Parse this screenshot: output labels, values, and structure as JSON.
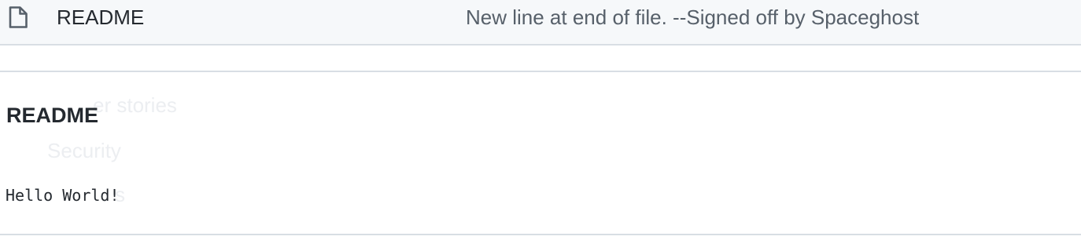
{
  "file_list": {
    "rows": [
      {
        "icon": "file-icon",
        "name": "README",
        "commit_message": "New line at end of file. --Signed off by Spaceghost"
      }
    ]
  },
  "readme": {
    "title": "README",
    "content": "Hello World!"
  },
  "background_ghost_text": {
    "line_1": "er stories",
    "line_2": "Security",
    "line_3": "s"
  },
  "colors": {
    "row_background": "#f6f8fa",
    "border": "#d8dee4",
    "text": "#24292f",
    "muted_text": "#57606a"
  }
}
